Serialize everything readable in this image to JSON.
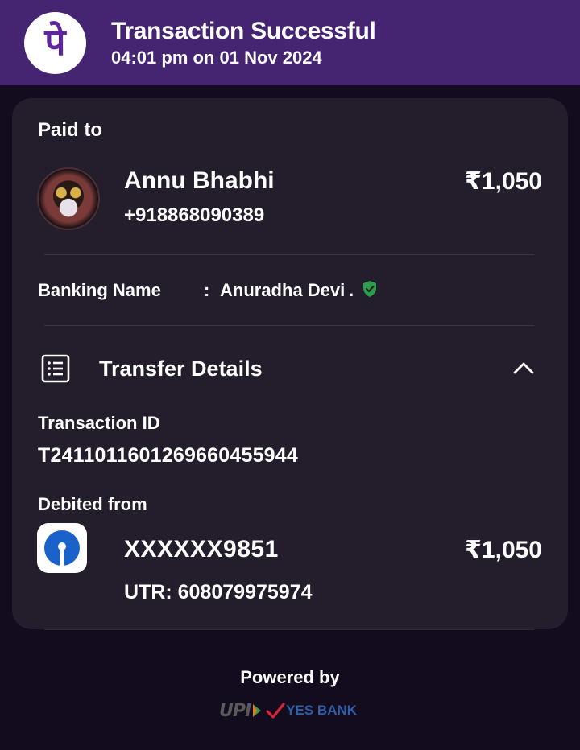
{
  "header": {
    "title": "Transaction Successful",
    "subtitle": "04:01 pm on 01 Nov 2024",
    "logo_glyph": "पे",
    "background": "#452472"
  },
  "paid_to": {
    "label": "Paid to",
    "name": "Annu Bhabhi",
    "phone": "+918868090389",
    "amount": "₹1,050"
  },
  "banking": {
    "label": "Banking Name",
    "colon": ":",
    "value": "Anuradha Devi",
    "dot": ".",
    "verified_icon": "verified-shield-icon",
    "verified_color": "#2e9b4f"
  },
  "transfer": {
    "title": "Transfer Details",
    "list_icon": "receipt-list-icon",
    "collapse_icon": "chevron-up-icon",
    "transaction_id_label": "Transaction ID",
    "transaction_id": "T2411011601269660455944",
    "debited_from_label": "Debited from",
    "account": "XXXXXX9851",
    "amount": "₹1,050",
    "utr": "UTR: 608079975974",
    "bank_icon": "bank-logo-icon",
    "bank_color": "#1a62c9"
  },
  "footer": {
    "powered_by": "Powered by",
    "upi_text": "UPI",
    "yes_bank_text": "YES BANK"
  }
}
